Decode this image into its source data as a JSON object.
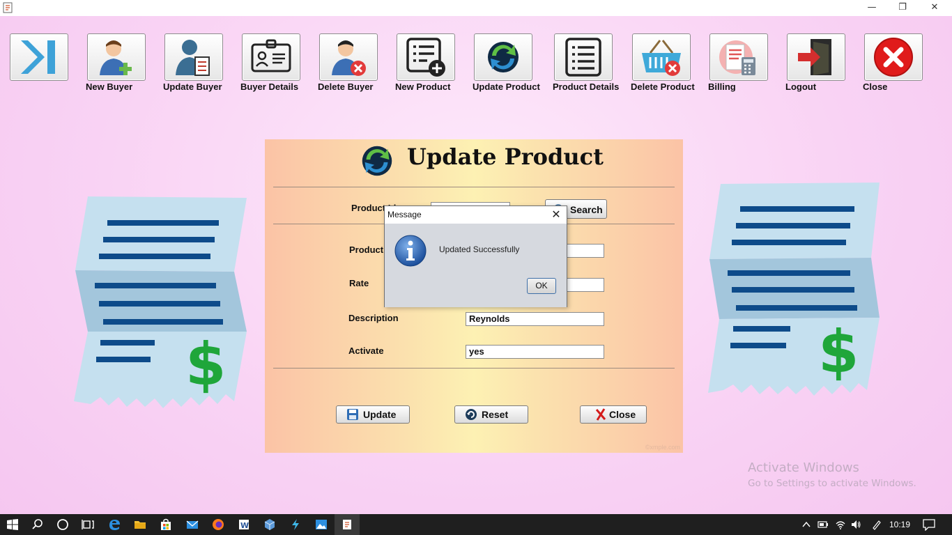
{
  "window": {
    "minimize": "—",
    "restore": "❐",
    "close": "✕"
  },
  "toolbar": {
    "items": [
      {
        "label": "",
        "icon": "skip-forward-icon"
      },
      {
        "label": "New Buyer",
        "icon": "add-user-icon"
      },
      {
        "label": "Update Buyer",
        "icon": "edit-user-icon"
      },
      {
        "label": "Buyer Details",
        "icon": "id-card-icon"
      },
      {
        "label": "Delete Buyer",
        "icon": "delete-user-icon"
      },
      {
        "label": "New Product",
        "icon": "add-list-icon"
      },
      {
        "label": "Update Product",
        "icon": "refresh-icon"
      },
      {
        "label": "Product Details",
        "icon": "list-icon"
      },
      {
        "label": "Delete Product",
        "icon": "delete-basket-icon"
      },
      {
        "label": "Billing",
        "icon": "calculator-bill-icon"
      },
      {
        "label": "Logout",
        "icon": "exit-door-icon"
      },
      {
        "label": "Close",
        "icon": "close-circle-icon"
      }
    ]
  },
  "form": {
    "title": "Update Product",
    "product_id_label": "Product Id",
    "product_id_value": "",
    "search_button": "Search",
    "product_name_label": "Product",
    "product_name_value": "",
    "rate_label": "Rate",
    "rate_value": "",
    "description_label": "Description",
    "description_value": "Reynolds",
    "activate_label": "Activate",
    "activate_value": "yes",
    "update_button": "Update",
    "reset_button": "Reset",
    "close_button": "Close",
    "watermark": "©xmple.com"
  },
  "dialog": {
    "title": "Message",
    "close": "✕",
    "message": "Updated Successfully",
    "ok_button": "OK"
  },
  "activate_windows": {
    "line1": "Activate Windows",
    "line2": "Go to Settings to activate Windows."
  },
  "taskbar": {
    "clock": "10:19"
  },
  "colors": {
    "background": "#f9d3f4",
    "receipt_light": "#c5e0ef",
    "receipt_dark": "#a3c6dc",
    "receipt_lines": "#0d4b8a",
    "dollar": "#1fa63a",
    "taskbar": "#1f1f1f"
  }
}
